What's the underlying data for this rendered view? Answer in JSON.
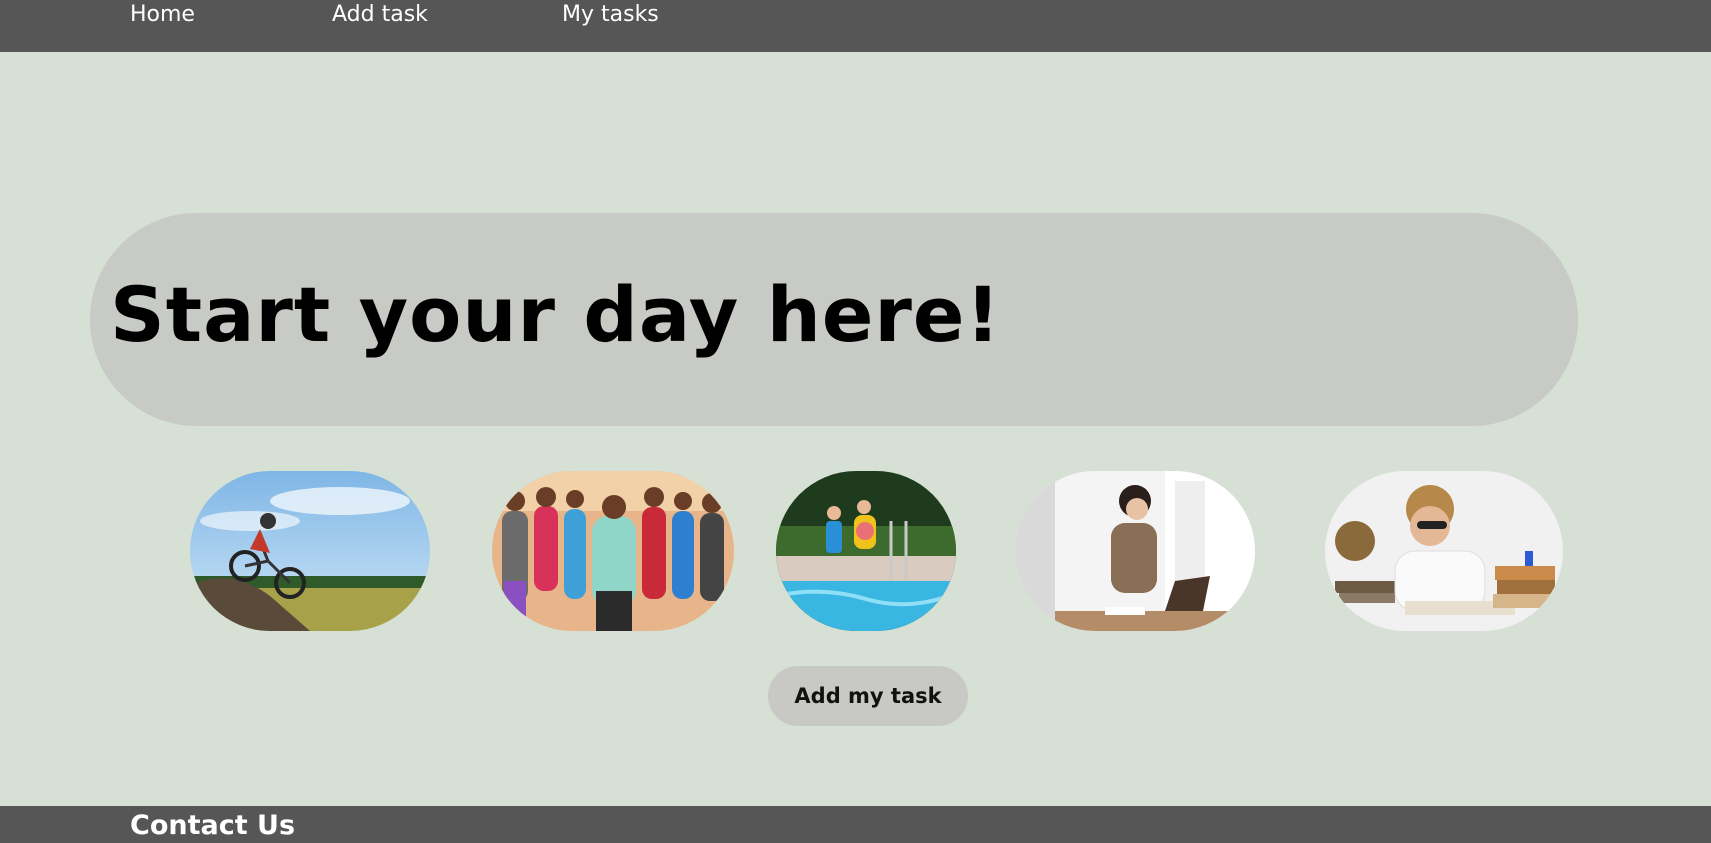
{
  "nav": {
    "items": [
      {
        "label": "Home"
      },
      {
        "label": "Add task"
      },
      {
        "label": "My tasks"
      }
    ]
  },
  "hero": {
    "title": "Start your day here!"
  },
  "gallery": {
    "images": [
      {
        "subject": "mountain-biker"
      },
      {
        "subject": "dance-fitness-class"
      },
      {
        "subject": "kids-jumping-into-pool"
      },
      {
        "subject": "woman-working-on-laptop"
      },
      {
        "subject": "tired-student-with-books"
      }
    ]
  },
  "actions": {
    "add_task_label": "Add my task"
  },
  "footer": {
    "title": "Contact Us"
  },
  "colors": {
    "page_background": "#d6e0d5",
    "nav_background": "#565656",
    "hero_background": "#c8cac5",
    "button_background": "#c8c9c5"
  }
}
